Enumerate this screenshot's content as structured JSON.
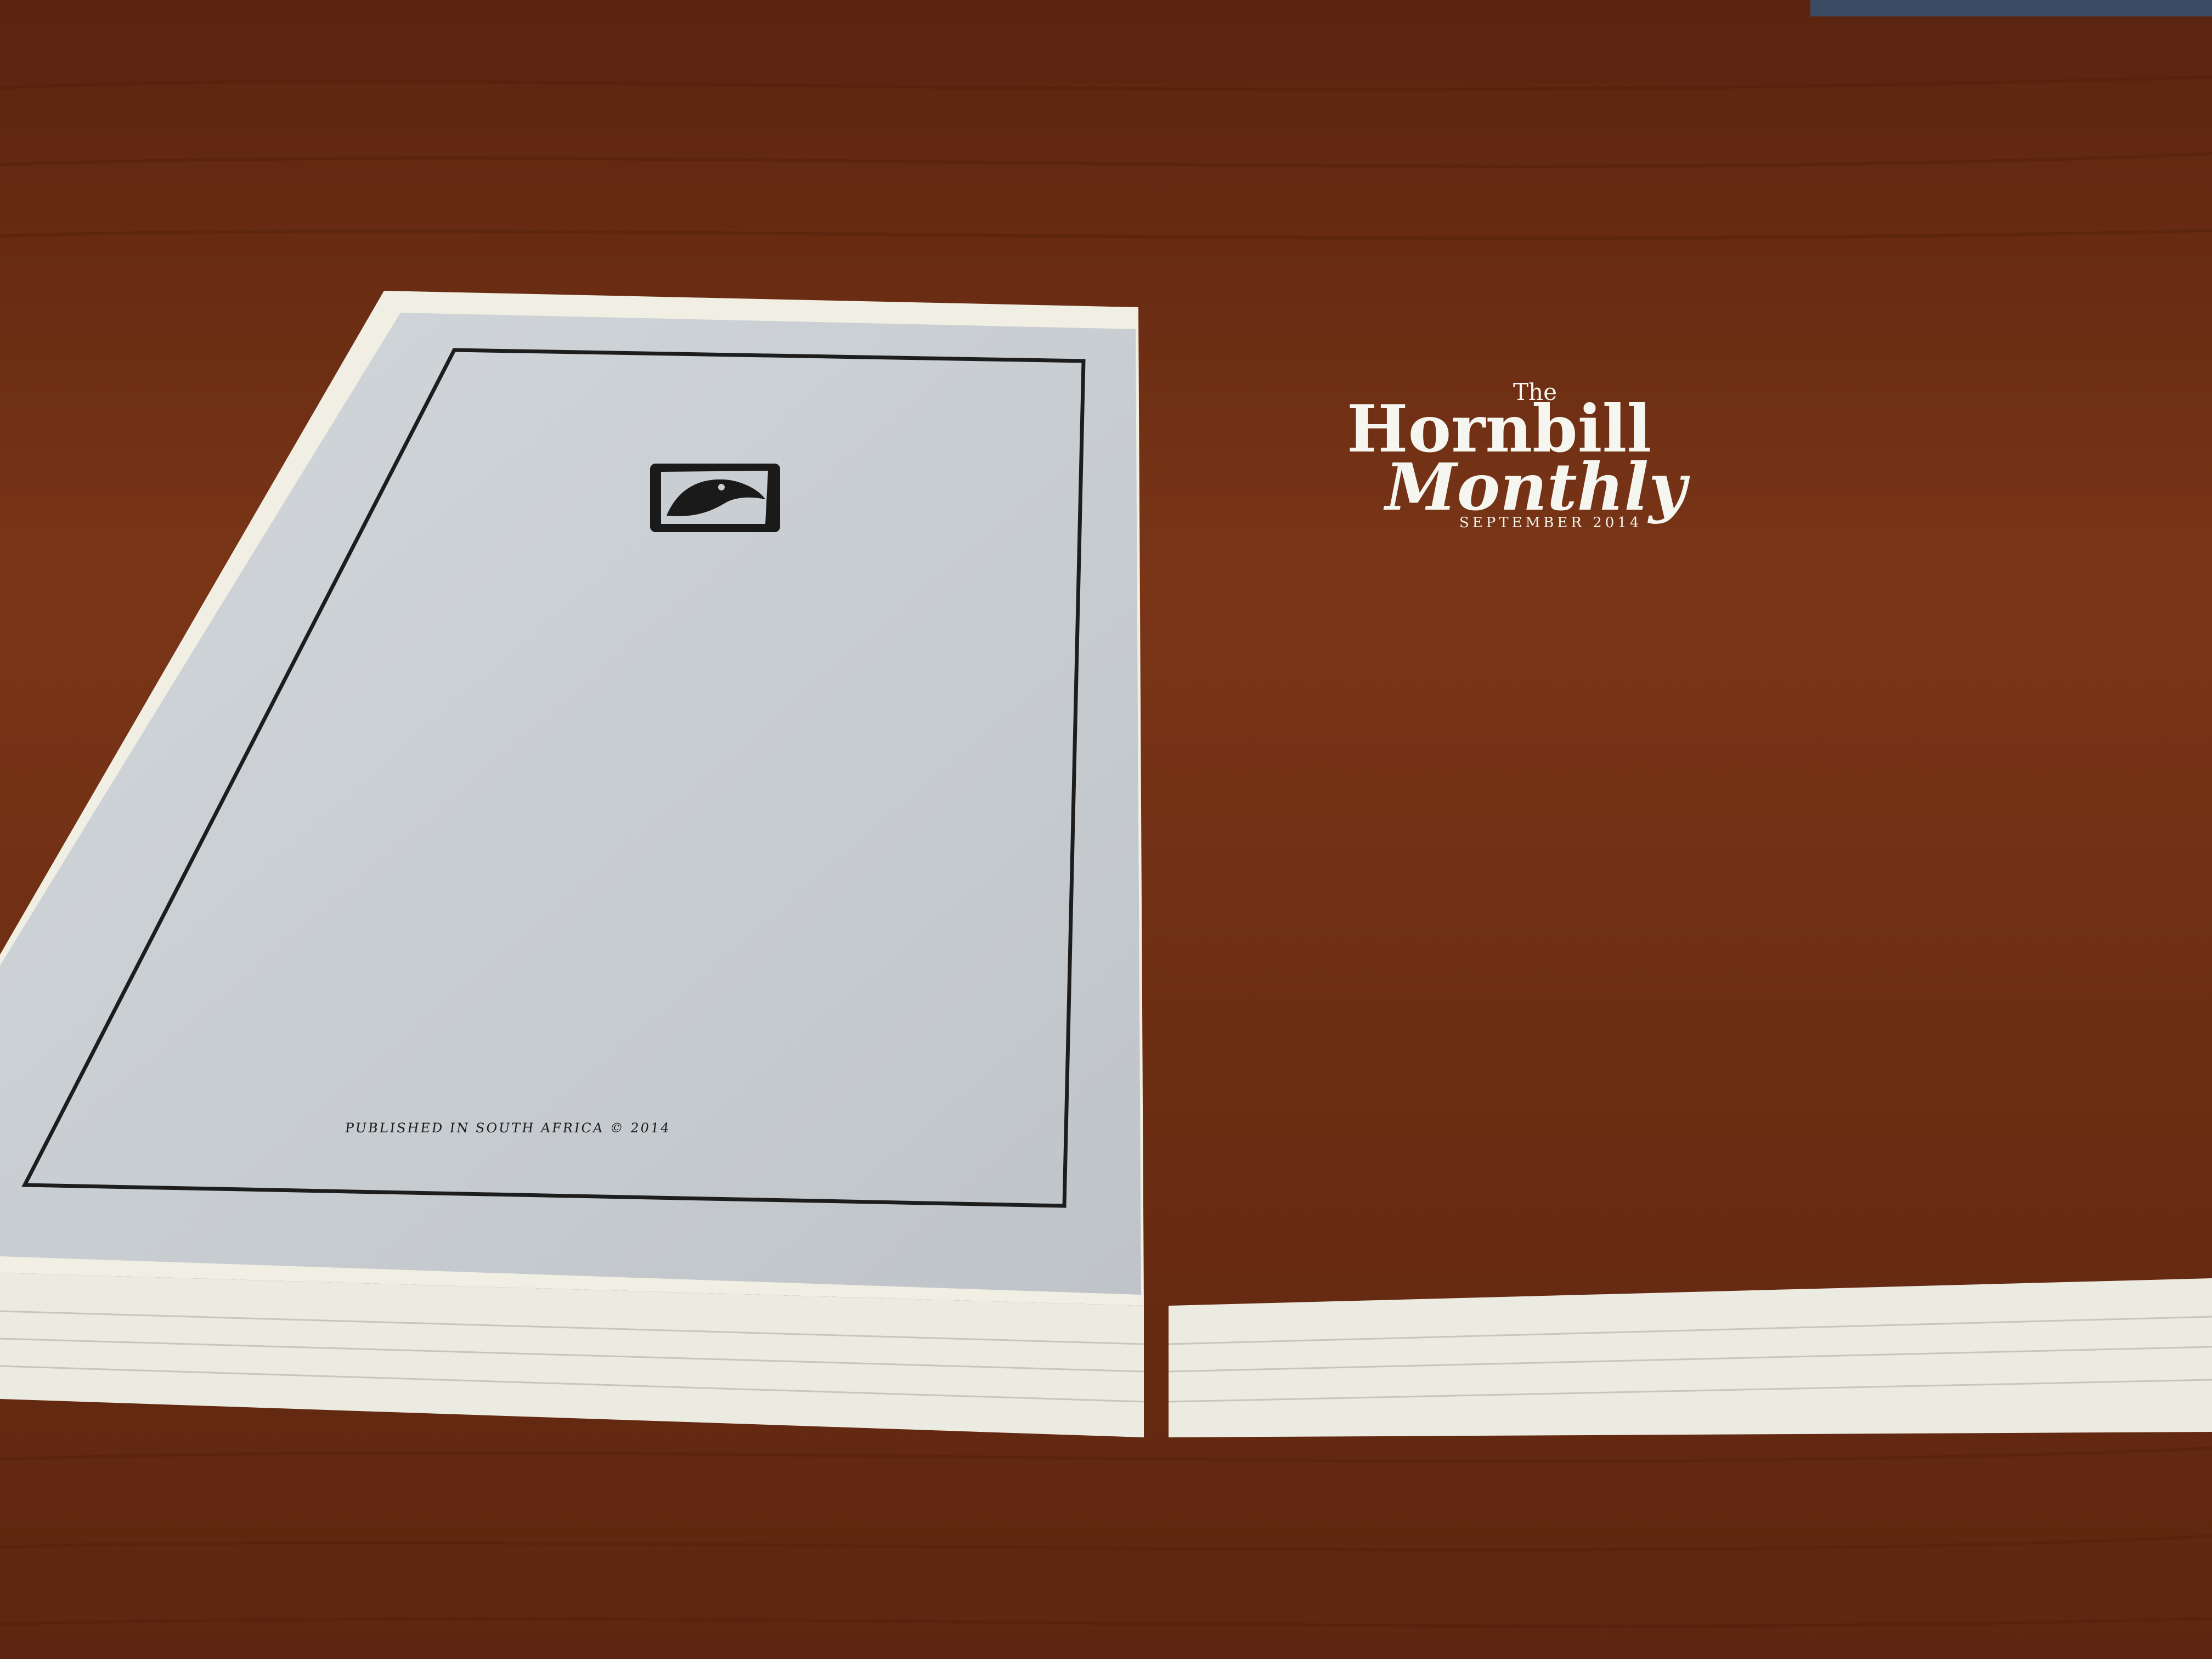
{
  "left_page": {
    "caption": "PUBLISHED IN SOUTH AFRICA © 2014",
    "emblem_icon": "hornbill-icon"
  },
  "cover": {
    "pre_title": "The",
    "title_line1": "Hornbill",
    "title_line2": "Monthly",
    "date": "SEPTEMBER 2014"
  },
  "colors": {
    "table_wood": "#6b2e14",
    "left_page": "#c9ced3",
    "camo_green": "#6f8a5a",
    "paper_edge": "#efeee6"
  }
}
